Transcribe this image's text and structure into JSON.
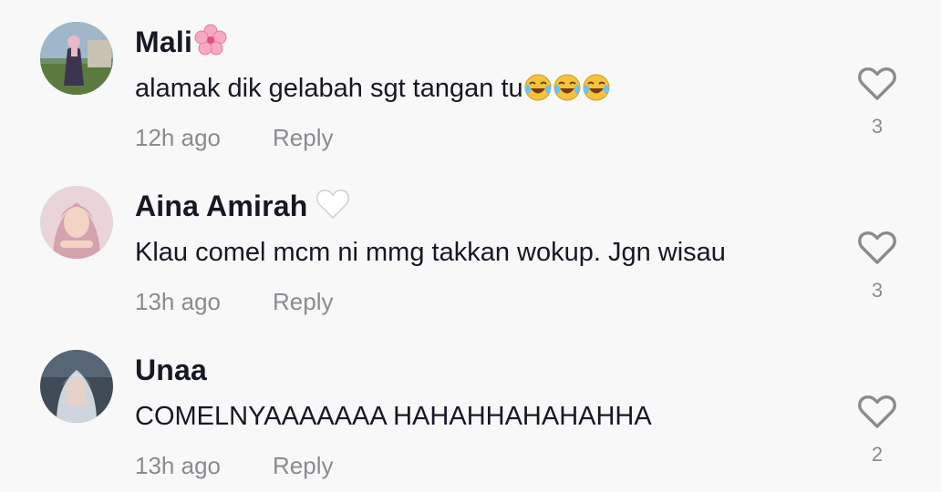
{
  "comments": [
    {
      "username": "Mali",
      "username_emoji": "cherry-blossom",
      "text": "alamak dik gelabah sgt tangan tu",
      "text_emoji": [
        "tears-of-joy",
        "tears-of-joy",
        "tears-of-joy"
      ],
      "time": "12h ago",
      "reply_label": "Reply",
      "likes": "3",
      "like_icon": "heart-outline-icon"
    },
    {
      "username": "Aina Amirah",
      "username_emoji": "white-heart",
      "text": "Klau comel mcm ni mmg takkan wokup. Jgn wisau",
      "time": "13h ago",
      "reply_label": "Reply",
      "likes": "3",
      "like_icon": "heart-outline-icon"
    },
    {
      "username": "Unaa",
      "text": "COMELNYAAAAAAA HAHAHHAHAHAHHA",
      "time": "13h ago",
      "reply_label": "Reply",
      "likes": "2",
      "like_icon": "heart-outline-icon"
    }
  ],
  "colors": {
    "background": "#f8f8f8",
    "primary_text": "#161823",
    "secondary_text": "#8a8b91"
  }
}
